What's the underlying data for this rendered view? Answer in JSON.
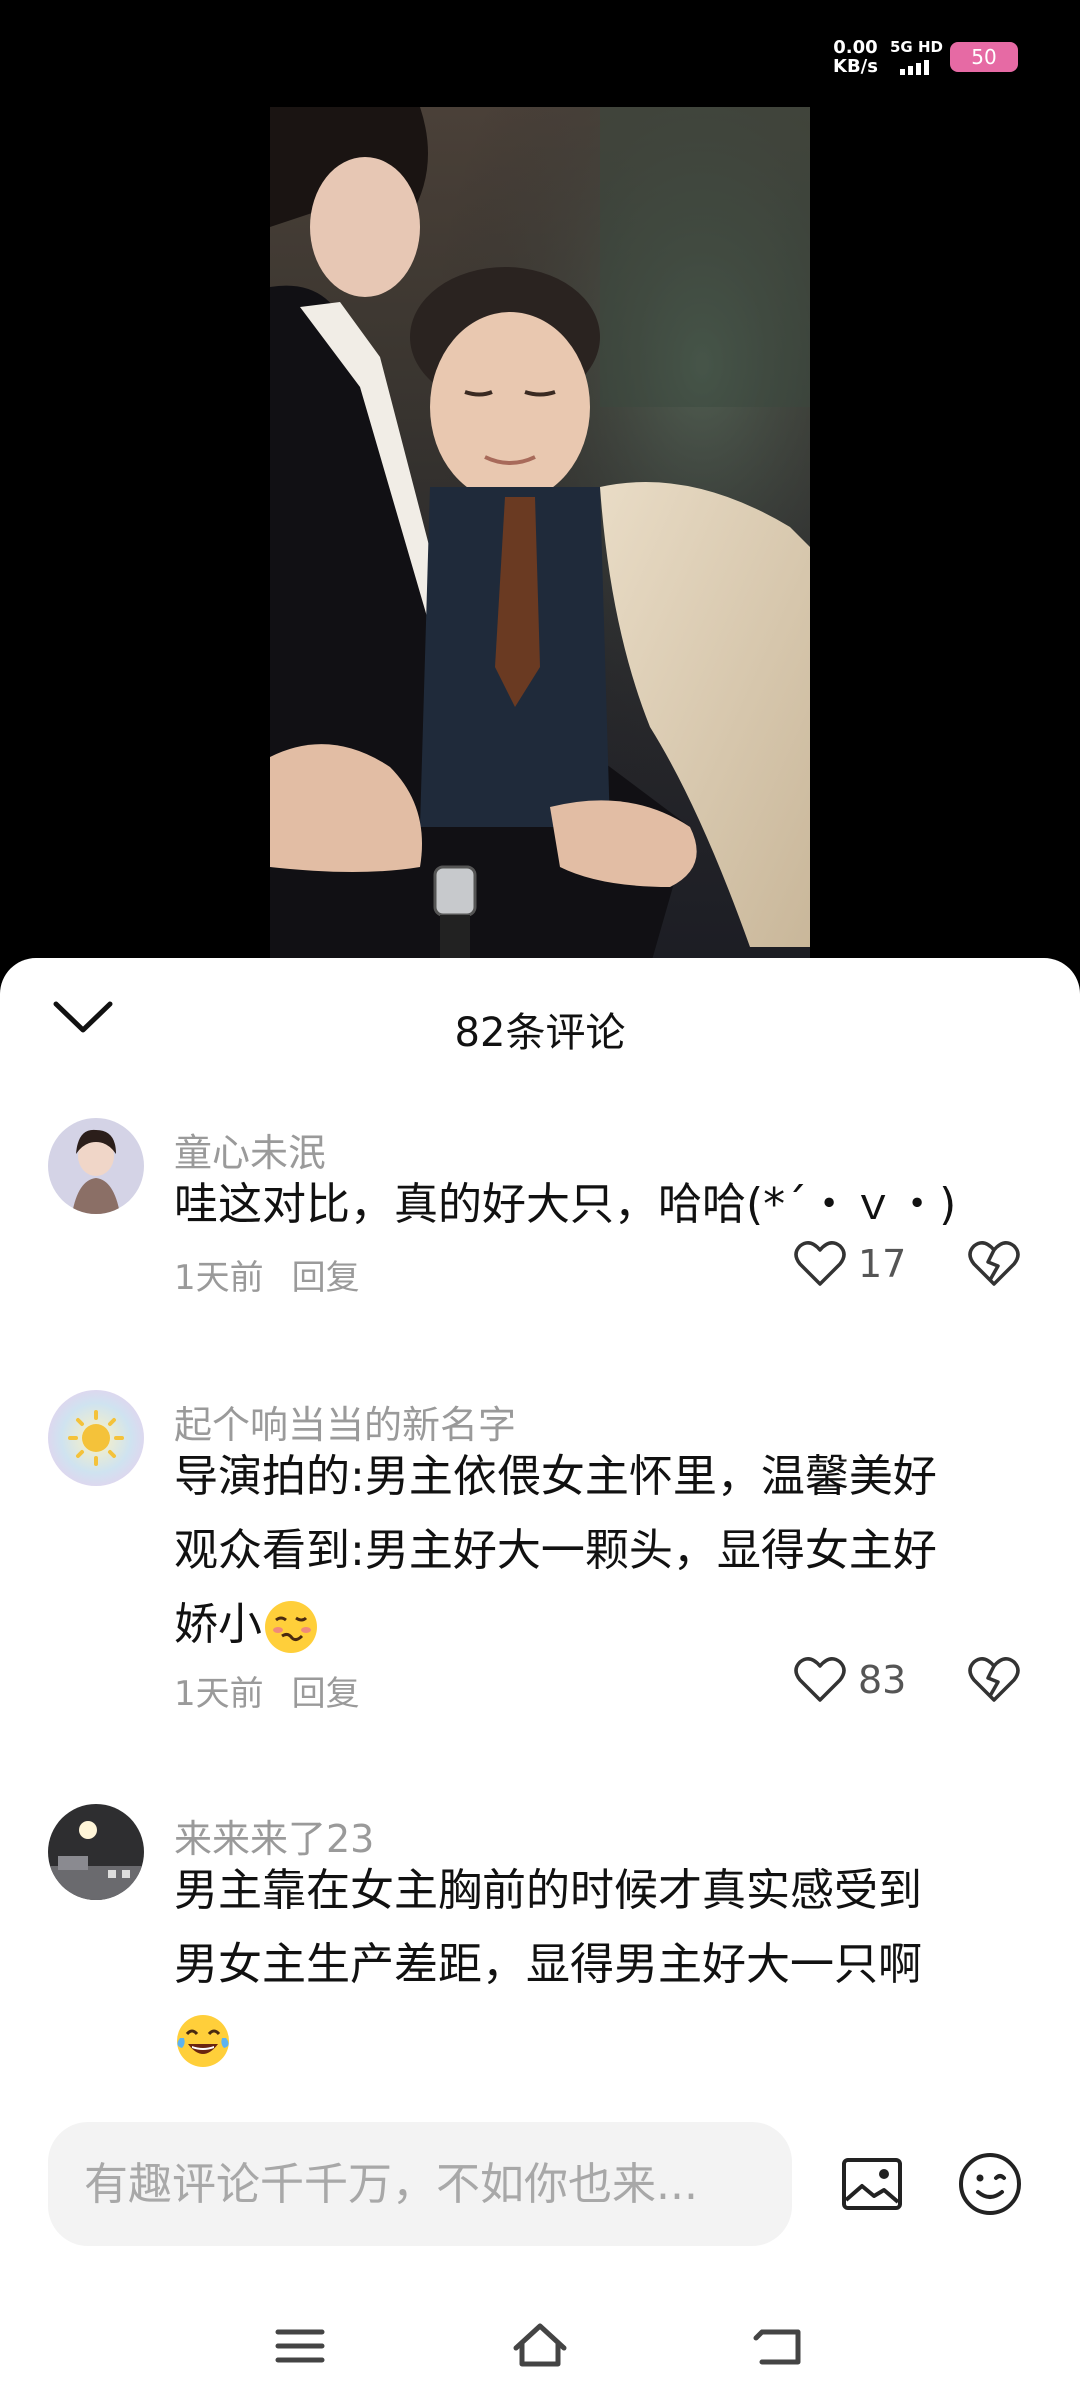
{
  "status_bar": {
    "net_speed_value": "0.00",
    "net_speed_unit": "KB/s",
    "network_type": "5G HD",
    "battery": "50"
  },
  "comments_panel": {
    "title": "82条评论",
    "comments": [
      {
        "username": "童心未泯",
        "text": "哇这对比，真的好大只，哈哈(*´・ｖ・)",
        "time": "1天前",
        "reply_label": "回复",
        "likes": "17"
      },
      {
        "username": "起个响当当的新名字",
        "text_line1": "导演拍的:男主依偎女主怀里，温馨美好",
        "text_line2": "观众看到:男主好大一颗头，显得女主好",
        "text_line3": "娇小",
        "emoji": "woozy-face-emoji",
        "time": "1天前",
        "reply_label": "回复",
        "likes": "83"
      },
      {
        "username": "来来来了23",
        "text_line1": "男主靠在女主胸前的时候才真实感受到",
        "text_line2": "男女主生产差距，显得男主好大一只啊",
        "emoji": "laughing-tears-emoji"
      }
    ]
  },
  "input_bar": {
    "placeholder": "有趣评论千千万，不如你也来..."
  },
  "icons": [
    "chevron-down-icon",
    "heart-icon",
    "broken-heart-icon",
    "image-icon",
    "smiley-icon",
    "menu-icon",
    "home-icon",
    "back-icon"
  ],
  "colors": {
    "battery": "#e66aa4",
    "secondary_text": "#9a9a9a",
    "input_bg": "#f3f3f3"
  }
}
